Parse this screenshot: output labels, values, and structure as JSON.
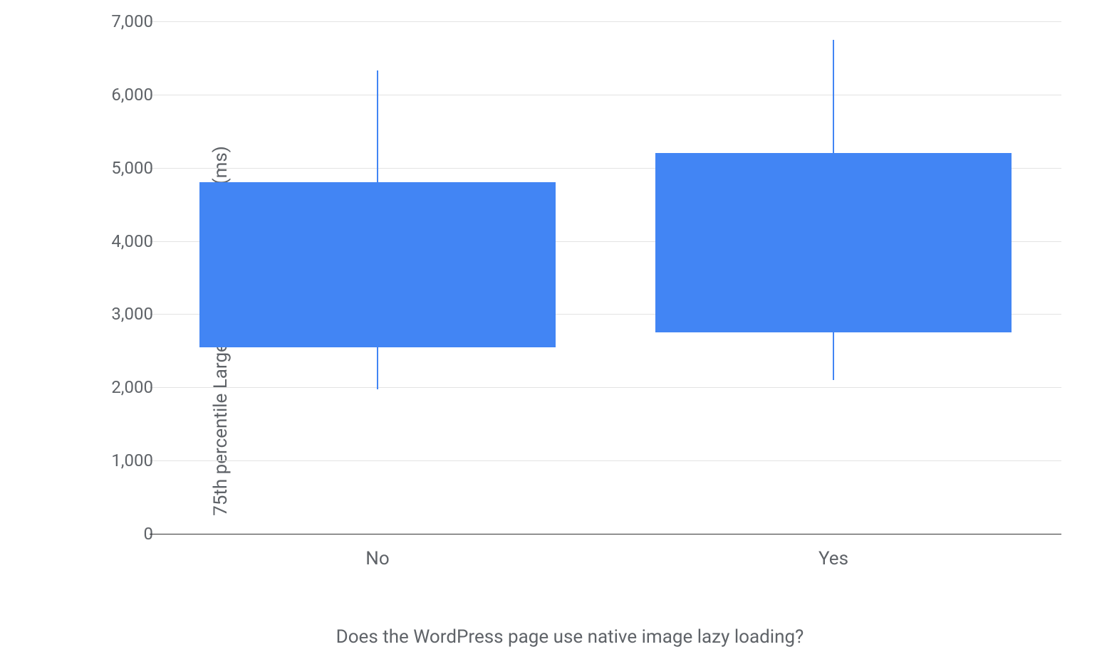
{
  "chart_data": {
    "type": "boxplot",
    "ylabel": "75th percentile Largest Contentful Paint (ms)",
    "xlabel": "Does the WordPress page use native image lazy loading?",
    "ylim": [
      0,
      7000
    ],
    "yticks": [
      0,
      1000,
      2000,
      3000,
      4000,
      5000,
      6000,
      7000
    ],
    "ytick_labels": [
      "0",
      "1,000",
      "2,000",
      "3,000",
      "4,000",
      "5,000",
      "6,000",
      "7,000"
    ],
    "categories": [
      "No",
      "Yes"
    ],
    "series": [
      {
        "name": "No",
        "whisker_low": 1970,
        "q1": 2550,
        "q3": 4800,
        "whisker_high": 6330
      },
      {
        "name": "Yes",
        "whisker_low": 2100,
        "q1": 2750,
        "q3": 5200,
        "whisker_high": 6750
      }
    ],
    "box_color": "#4285f4"
  }
}
